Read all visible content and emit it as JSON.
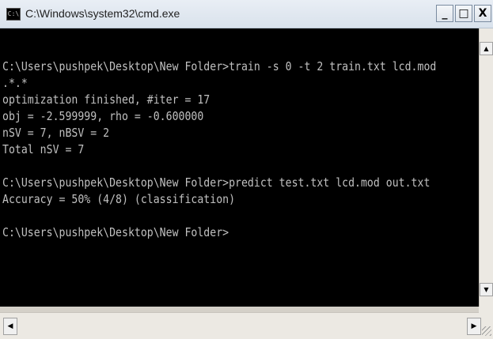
{
  "window": {
    "title": "C:\\Windows\\system32\\cmd.exe",
    "icon": "cmd-icon",
    "controls": {
      "minimize": "_",
      "maximize": "□",
      "close": "X"
    }
  },
  "console": {
    "lines": [
      "C:\\Users\\pushpek\\Desktop\\New Folder>train -s 0 -t 2 train.txt lcd.mod",
      ".*.*",
      "optimization finished, #iter = 17",
      "obj = -2.599999, rho = -0.600000",
      "nSV = 7, nBSV = 2",
      "Total nSV = 7",
      "",
      "C:\\Users\\pushpek\\Desktop\\New Folder>predict test.txt lcd.mod out.txt",
      "Accuracy = 50% (4/8) (classification)",
      "",
      "C:\\Users\\pushpek\\Desktop\\New Folder>"
    ],
    "background": "#000000",
    "foreground": "#c0c0c0"
  },
  "scrollbars": {
    "up_arrow": "▲",
    "down_arrow": "▼",
    "left_arrow": "◀",
    "right_arrow": "▶"
  }
}
